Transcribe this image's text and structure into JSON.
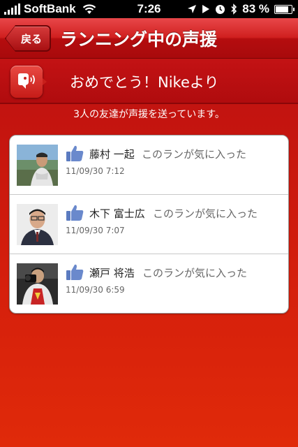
{
  "status_bar": {
    "carrier": "SoftBank",
    "time": "7:26",
    "battery": "83 %",
    "battery_level": 0.83
  },
  "nav": {
    "back_label": "戻る",
    "title": "ランニング中の声援"
  },
  "banner": {
    "text": "おめでとう！Nikeより"
  },
  "summary": {
    "text": "3人の友達が声援を送っています。"
  },
  "cheers": [
    {
      "name": "藤村 一起",
      "action": "このランが気に入った",
      "time": "11/09/30  7:12"
    },
    {
      "name": "木下 富士広",
      "action": "このランが気に入った",
      "time": "11/09/30  7:07"
    },
    {
      "name": "瀬戸 将浩",
      "action": "このランが気に入った",
      "time": "11/09/30  6:59"
    }
  ],
  "colors": {
    "accent_red": "#c8201b",
    "like_blue": "#5b7bc0"
  }
}
